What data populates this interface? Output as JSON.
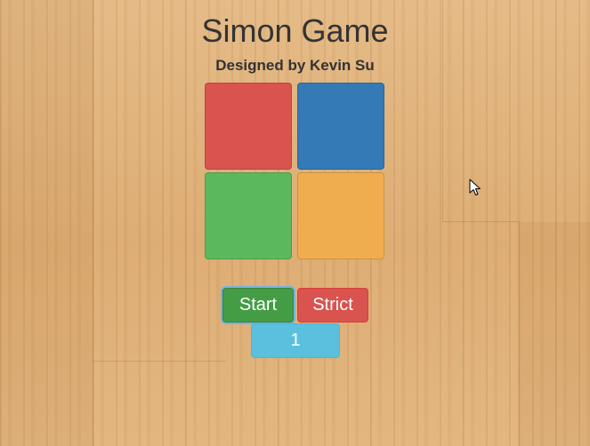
{
  "game": {
    "title": "Simon Game",
    "subtitle": "Designed by Kevin Su"
  },
  "pads": [
    {
      "name": "red",
      "color": "#d9534f"
    },
    {
      "name": "blue",
      "color": "#337ab7"
    },
    {
      "name": "green",
      "color": "#5cb85c"
    },
    {
      "name": "yellow",
      "color": "#f0ad4e"
    }
  ],
  "controls": {
    "start_label": "Start",
    "strict_label": "Strict",
    "count": "1"
  },
  "colors": {
    "start": "#449d44",
    "strict": "#d9534f",
    "count": "#5bc0de",
    "background": "#e0b27c"
  },
  "icons": {
    "cursor": "pointer-cursor-icon"
  }
}
